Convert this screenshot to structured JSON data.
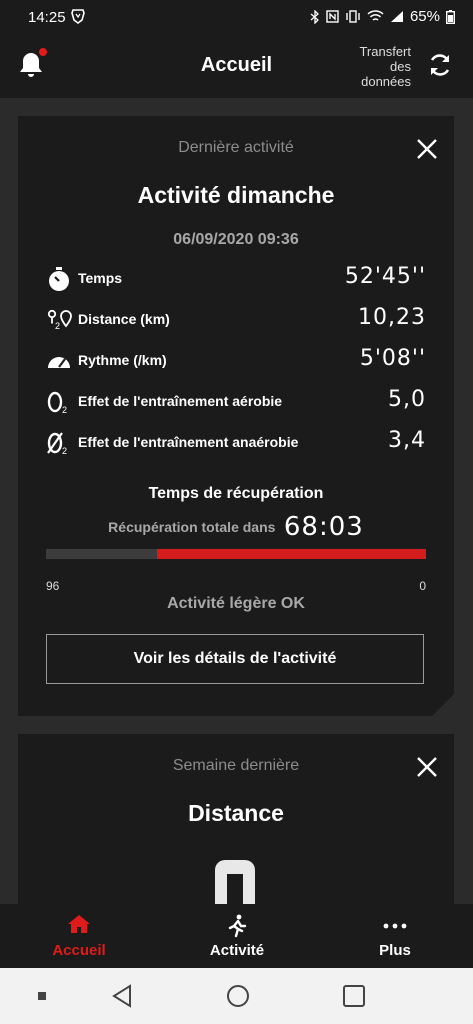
{
  "status_bar": {
    "time": "14:25",
    "battery": "65%"
  },
  "app_bar": {
    "title": "Accueil",
    "transfer_line1": "Transfert",
    "transfer_line2": "des",
    "transfer_line3": "données"
  },
  "last_activity": {
    "header": "Dernière activité",
    "title": "Activité dimanche",
    "datetime": "06/09/2020 09:36",
    "metrics": [
      {
        "icon": "stopwatch-icon",
        "label": "Temps",
        "value": "52'45''"
      },
      {
        "icon": "distance-pin-icon",
        "label": "Distance (km)",
        "value": "10,23"
      },
      {
        "icon": "pace-gauge-icon",
        "label": "Rythme (/km)",
        "value": "5'08''"
      },
      {
        "icon": "o2-aerobic-icon",
        "label": "Effet de l'entraînement aérobie",
        "value": "5,0"
      },
      {
        "icon": "o2-anaerobic-icon",
        "label": "Effet de l'entraînement anaérobie",
        "value": "3,4"
      }
    ],
    "recovery": {
      "title": "Temps de récupération",
      "total_label": "Récupération totale dans",
      "total_value": "68:03",
      "scale_max": "96",
      "scale_min": "0",
      "remaining_fraction": 0.708,
      "status": "Activité légère OK"
    },
    "details_button": "Voir les détails de l'activité"
  },
  "last_week": {
    "header": "Semaine dernière",
    "title": "Distance"
  },
  "bottom_nav": [
    {
      "label": "Accueil",
      "icon": "home-icon",
      "active": true
    },
    {
      "label": "Activité",
      "icon": "runner-icon",
      "active": false
    },
    {
      "label": "Plus",
      "icon": "more-dots-icon",
      "active": false
    }
  ],
  "colors": {
    "accent": "#e01b1b",
    "card": "#1b1b1b",
    "background": "#2b2b2b"
  }
}
